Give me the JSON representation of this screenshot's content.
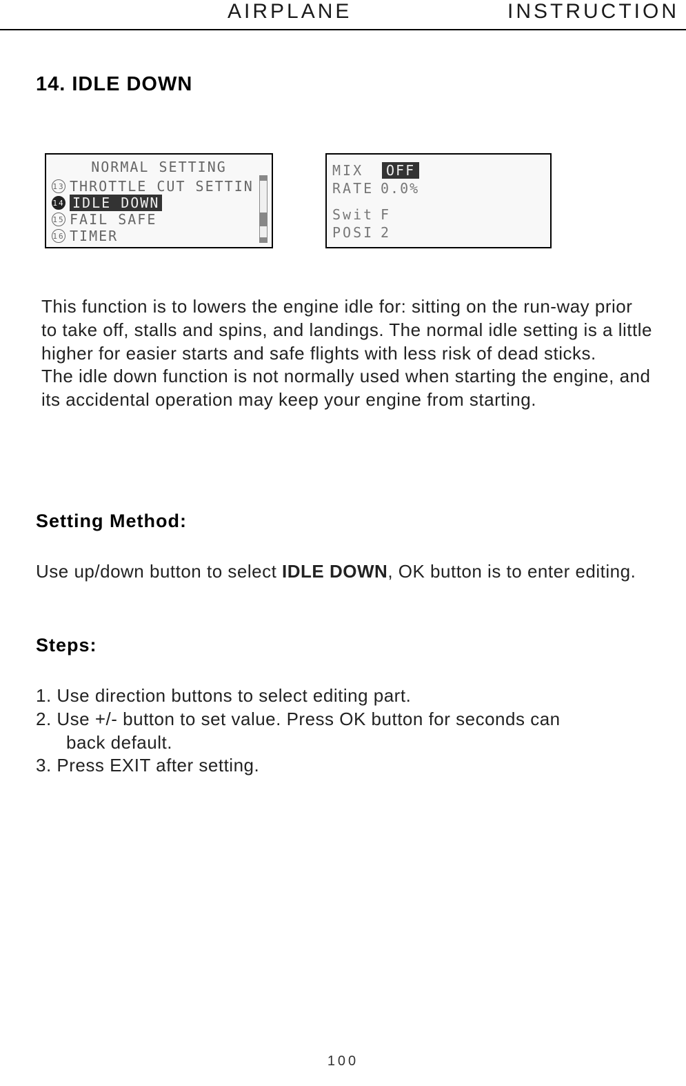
{
  "header": {
    "left": "AIRPLANE",
    "right": "INSTRUCTION"
  },
  "section_title": "14. IDLE DOWN",
  "lcd_left": {
    "title": "NORMAL SETTING",
    "items": [
      {
        "num": "13",
        "label": "THROTTLE CUT SETTIN",
        "selected": false
      },
      {
        "num": "14",
        "label": "IDLE DOWN",
        "selected": true
      },
      {
        "num": "15",
        "label": "FAIL SAFE",
        "selected": false
      },
      {
        "num": "16",
        "label": "TIMER",
        "selected": false
      }
    ]
  },
  "lcd_right": {
    "mix_label": "MIX",
    "mix_value": "OFF",
    "rate_label": "RATE",
    "rate_value": "0.0%",
    "swit_label": "Swit",
    "swit_value": "F",
    "posi_label": "POSI",
    "posi_value": "2"
  },
  "description_p1": "This function is to lowers the engine idle for: sitting on the run-way prior to take off, stalls and spins, and landings. The normal idle setting is a little higher for easier starts and safe flights with less risk of dead sticks.",
  "description_p2": "The idle down function is not normally used when starting the engine, and its accidental operation may keep your engine from starting.",
  "setting_method_heading": "Setting Method:",
  "setting_method_pre": "Use up/down button to select ",
  "setting_method_bold": "IDLE DOWN",
  "setting_method_post": ", OK button is to enter editing.",
  "steps_heading": "Steps:",
  "steps": {
    "s1": "1. Use direction buttons to select editing part.",
    "s2a": "2. Use +/- button to set value. Press OK button for seconds can",
    "s2b": "back default.",
    "s3": "3. Press EXIT after setting."
  },
  "page_number": "100"
}
